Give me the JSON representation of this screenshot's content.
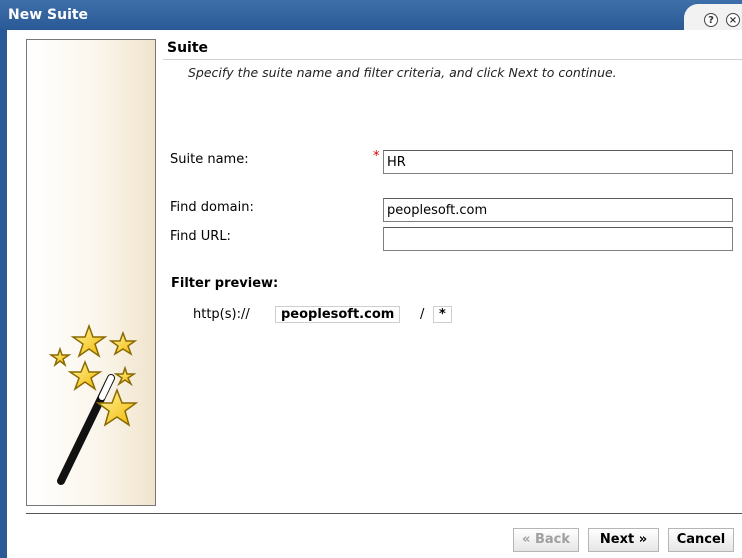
{
  "window": {
    "title": "New Suite"
  },
  "section": {
    "title": "Suite",
    "description": "Specify the suite name and filter criteria, and click Next to continue."
  },
  "form": {
    "suite_name_label": "Suite name:",
    "required_marker": "*",
    "suite_name_value": "HR",
    "find_domain_label": "Find domain:",
    "find_domain_value": "peoplesoft.com",
    "find_url_label": "Find URL:",
    "find_url_value": ""
  },
  "filter_preview": {
    "title": "Filter preview:",
    "prefix": "http(s)://",
    "domain": "peoplesoft.com",
    "separator": "/",
    "path": "*"
  },
  "buttons": {
    "back": "« Back",
    "next": "Next »",
    "cancel": "Cancel"
  },
  "icons": {
    "help": "help-icon",
    "close": "close-icon",
    "wizard": "magic-wand-stars-icon"
  },
  "colors": {
    "title_bar": "#2a5a96",
    "required": "#dd0000"
  }
}
